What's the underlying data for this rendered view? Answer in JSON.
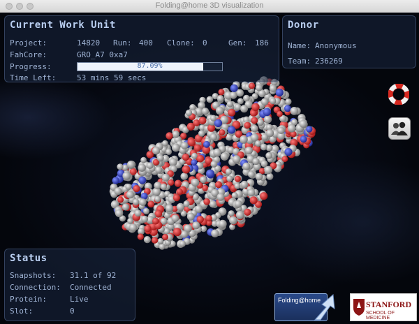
{
  "window": {
    "title": "Folding@home 3D visualization"
  },
  "work_unit": {
    "title": "Current Work Unit",
    "project_label": "Project:",
    "project": "14820",
    "run_label": "Run:",
    "run": "400",
    "clone_label": "Clone:",
    "clone": "0",
    "gen_label": "Gen:",
    "gen": "186",
    "fahcore_label": "FahCore:",
    "fahcore": "GRO_A7 0xa7",
    "progress_label": "Progress:",
    "progress_text": "87.09%",
    "progress_fraction": 0.8709,
    "time_left_label": "Time Left:",
    "time_left": "53 mins 59 secs"
  },
  "donor": {
    "title": "Donor",
    "name_label": "Name:",
    "name": "Anonymous",
    "team_label": "Team:",
    "team": "236269"
  },
  "status": {
    "title": "Status",
    "snapshots_label": "Snapshots:",
    "snapshots": "31.1 of 92",
    "connection_label": "Connection:",
    "connection": "Connected",
    "protein_label": "Protein:",
    "protein": "Live",
    "slot_label": "Slot:",
    "slot": "0"
  },
  "logos": {
    "fah": "Folding@home",
    "stanford": "STANFORD",
    "stanford_sub": "SCHOOL OF MEDICINE"
  },
  "icons": {
    "help": "lifebuoy-icon",
    "users": "users-icon"
  },
  "colors": {
    "oxygen": "#d92a2a",
    "nitrogen": "#2f45d8",
    "carbon": "#b8b8b8",
    "panel_text": "#9fb3d4",
    "title_text": "#b9cef0"
  }
}
